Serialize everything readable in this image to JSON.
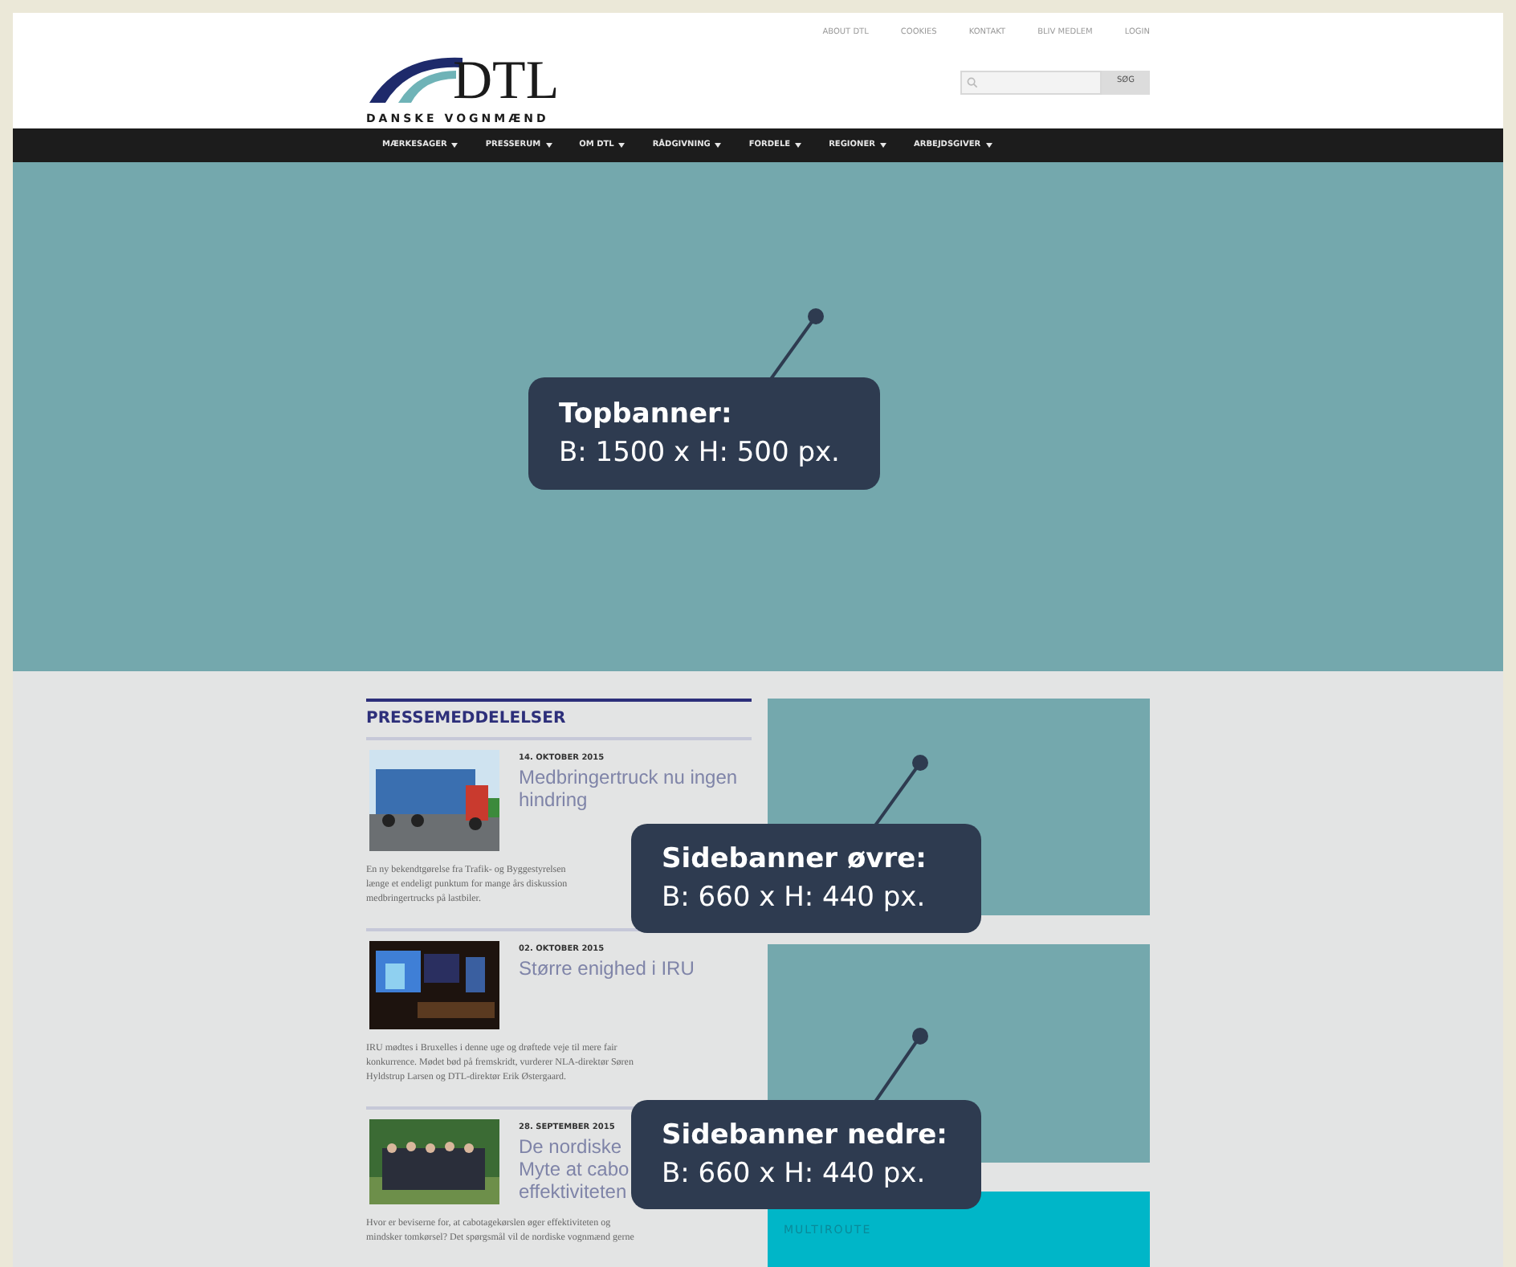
{
  "header": {
    "logo": {
      "wordmark": "DTL",
      "tagline": "DANSKE VOGNMÆND"
    },
    "top_links": [
      "ABOUT DTL",
      "COOKIES",
      "KONTAKT",
      "BLIV MEDLEM",
      "LOGIN"
    ],
    "search": {
      "button": "SØG"
    }
  },
  "nav": [
    "MÆRKESAGER",
    "PRESSERUM",
    "OM DTL",
    "RÅDGIVNING",
    "FORDELE",
    "REGIONER",
    "ARBEJDSGIVER"
  ],
  "press": {
    "heading": "PRESSEMEDDELELSER",
    "articles": [
      {
        "date": "14. OKTOBER 2015",
        "title_lines": [
          "Medbringertruck nu ingen",
          "hindring"
        ],
        "body_lines": [
          "En ny bekendtgørelse fra Trafik- og Byggestyrelsen",
          "længe et endeligt punktum for mange års diskussion",
          "medbringertrucks på lastbiler."
        ]
      },
      {
        "date": "02. OKTOBER 2015",
        "title_lines": [
          "Større enighed i IRU"
        ],
        "body_lines": [
          "IRU mødtes i Bruxelles i denne uge og drøftede veje til mere fair",
          "konkurrence. Mødet bød på fremskridt, vurderer NLA-direktør Søren",
          "Hyldstrup Larsen og DTL-direktør Erik Østergaard."
        ]
      },
      {
        "date": "28. SEPTEMBER 2015",
        "title_lines": [
          "De nordiske",
          "Myte at cabo",
          "effektiviteten"
        ],
        "body_lines": [
          "Hvor er beviserne for, at cabotagekørslen øger effektiviteten og",
          "mindsker tomkørsel? Det spørgsmål vil de nordiske vognmænd gerne"
        ]
      }
    ]
  },
  "sidebar": {
    "box_title": "MULTIROUTE"
  },
  "callouts": [
    {
      "title": "Topbanner:",
      "size": "B: 1500 x H: 500 px."
    },
    {
      "title": "Sidebanner øvre:",
      "size": "B: 660 x H: 440 px."
    },
    {
      "title": "Sidebanner nedre:",
      "size": "B: 660 x H: 440 px."
    }
  ]
}
